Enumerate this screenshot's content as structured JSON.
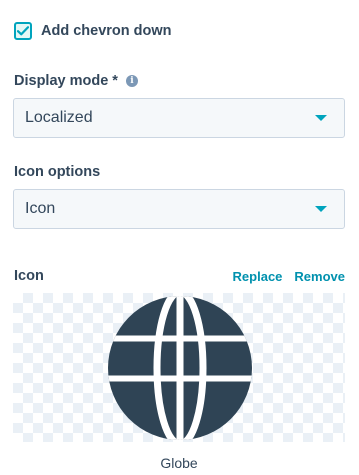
{
  "checkbox": {
    "label": "Add chevron down",
    "checked": true
  },
  "display_mode": {
    "label": "Display mode *",
    "info_icon": "info-icon",
    "value": "Localized"
  },
  "icon_options": {
    "label": "Icon options",
    "value": "Icon"
  },
  "icon": {
    "label": "Icon",
    "replace_label": "Replace",
    "remove_label": "Remove",
    "preview_icon": "globe-icon",
    "caption": "Globe"
  },
  "colors": {
    "accent": "#00a4bd",
    "link": "#0091ae",
    "text": "#33475b",
    "icon_fill": "#2f4455"
  }
}
